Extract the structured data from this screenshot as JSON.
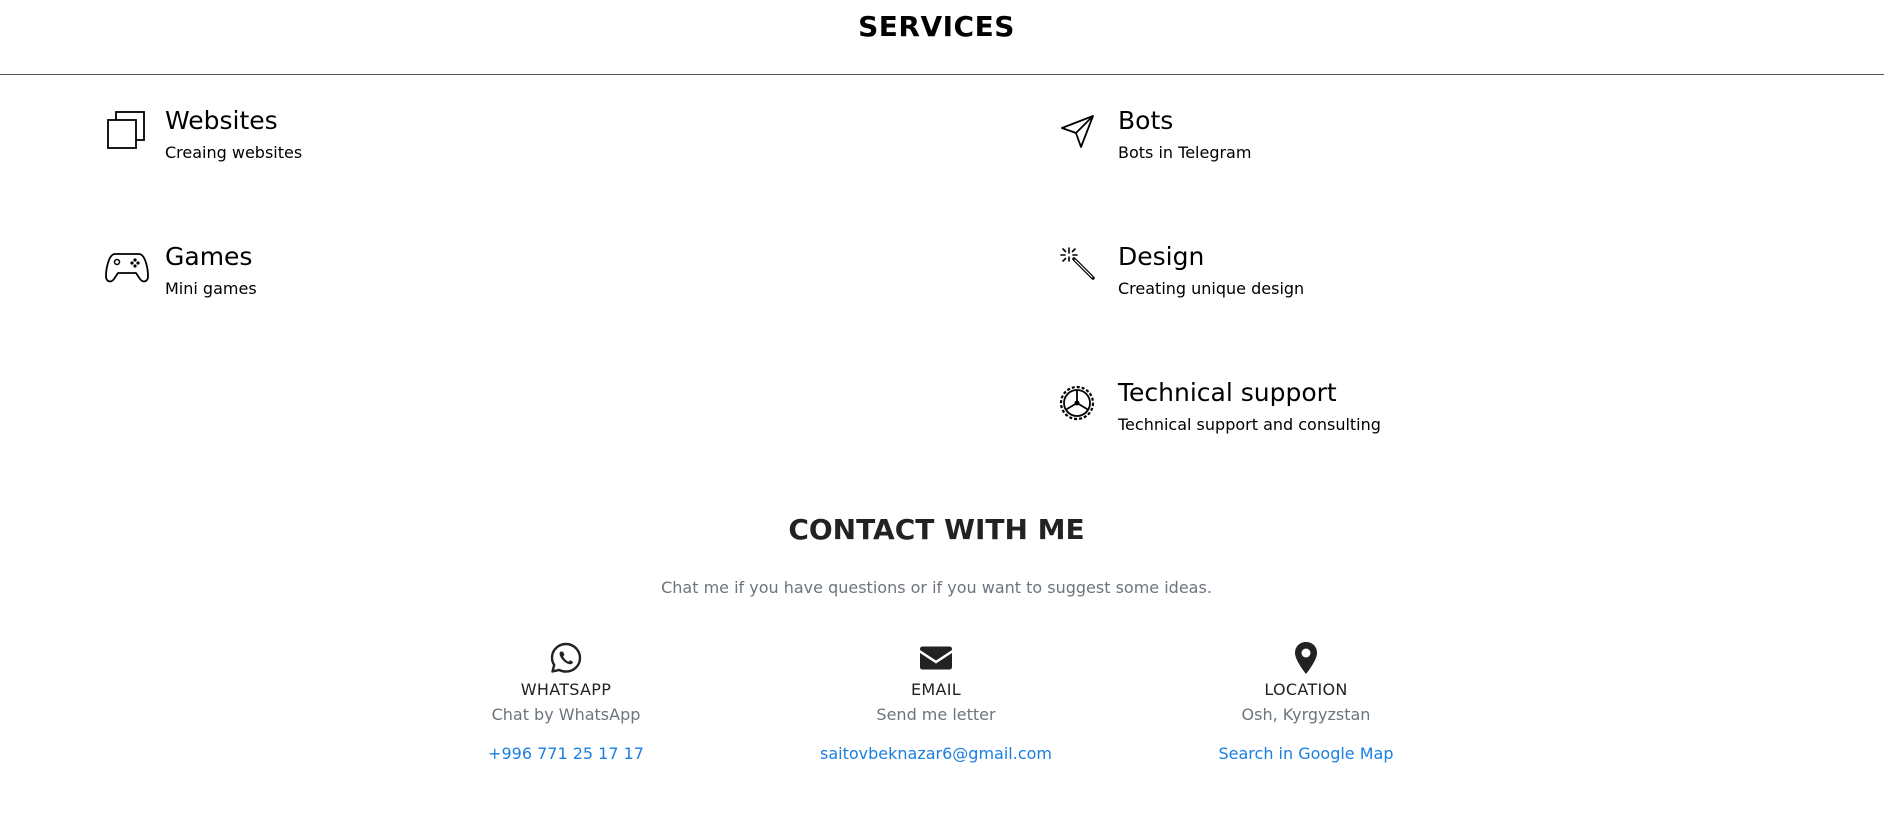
{
  "services": {
    "title": "SERVICES",
    "items": [
      {
        "name": "Websites",
        "desc": "Creaing websites",
        "icon": "stacked-squares-icon"
      },
      {
        "name": "Bots",
        "desc": "Bots in Telegram",
        "icon": "paper-plane-icon"
      },
      {
        "name": "Games",
        "desc": "Mini games",
        "icon": "gamepad-icon"
      },
      {
        "name": "Design",
        "desc": "Creating unique design",
        "icon": "magic-wand-icon"
      },
      {
        "name": "Technical support",
        "desc": "Technical support and consulting",
        "icon": "gear-icon"
      }
    ]
  },
  "contact": {
    "title": "CONTACT WITH ME",
    "subtitle": "Chat me if you have questions or if you want to suggest some ideas.",
    "columns": [
      {
        "label": "WHATSAPP",
        "desc": "Chat by WhatsApp",
        "link": "+996 771 25 17 17",
        "icon": "whatsapp-icon"
      },
      {
        "label": "EMAIL",
        "desc": "Send me letter",
        "link": "saitovbeknazar6@gmail.com",
        "icon": "envelope-icon"
      },
      {
        "label": "LOCATION",
        "desc": "Osh, Kyrgyzstan",
        "link": "Search in Google Map",
        "icon": "map-pin-icon"
      }
    ]
  },
  "colors": {
    "link": "#1a7fe0",
    "muted": "#6c757d",
    "heading": "#222222"
  }
}
